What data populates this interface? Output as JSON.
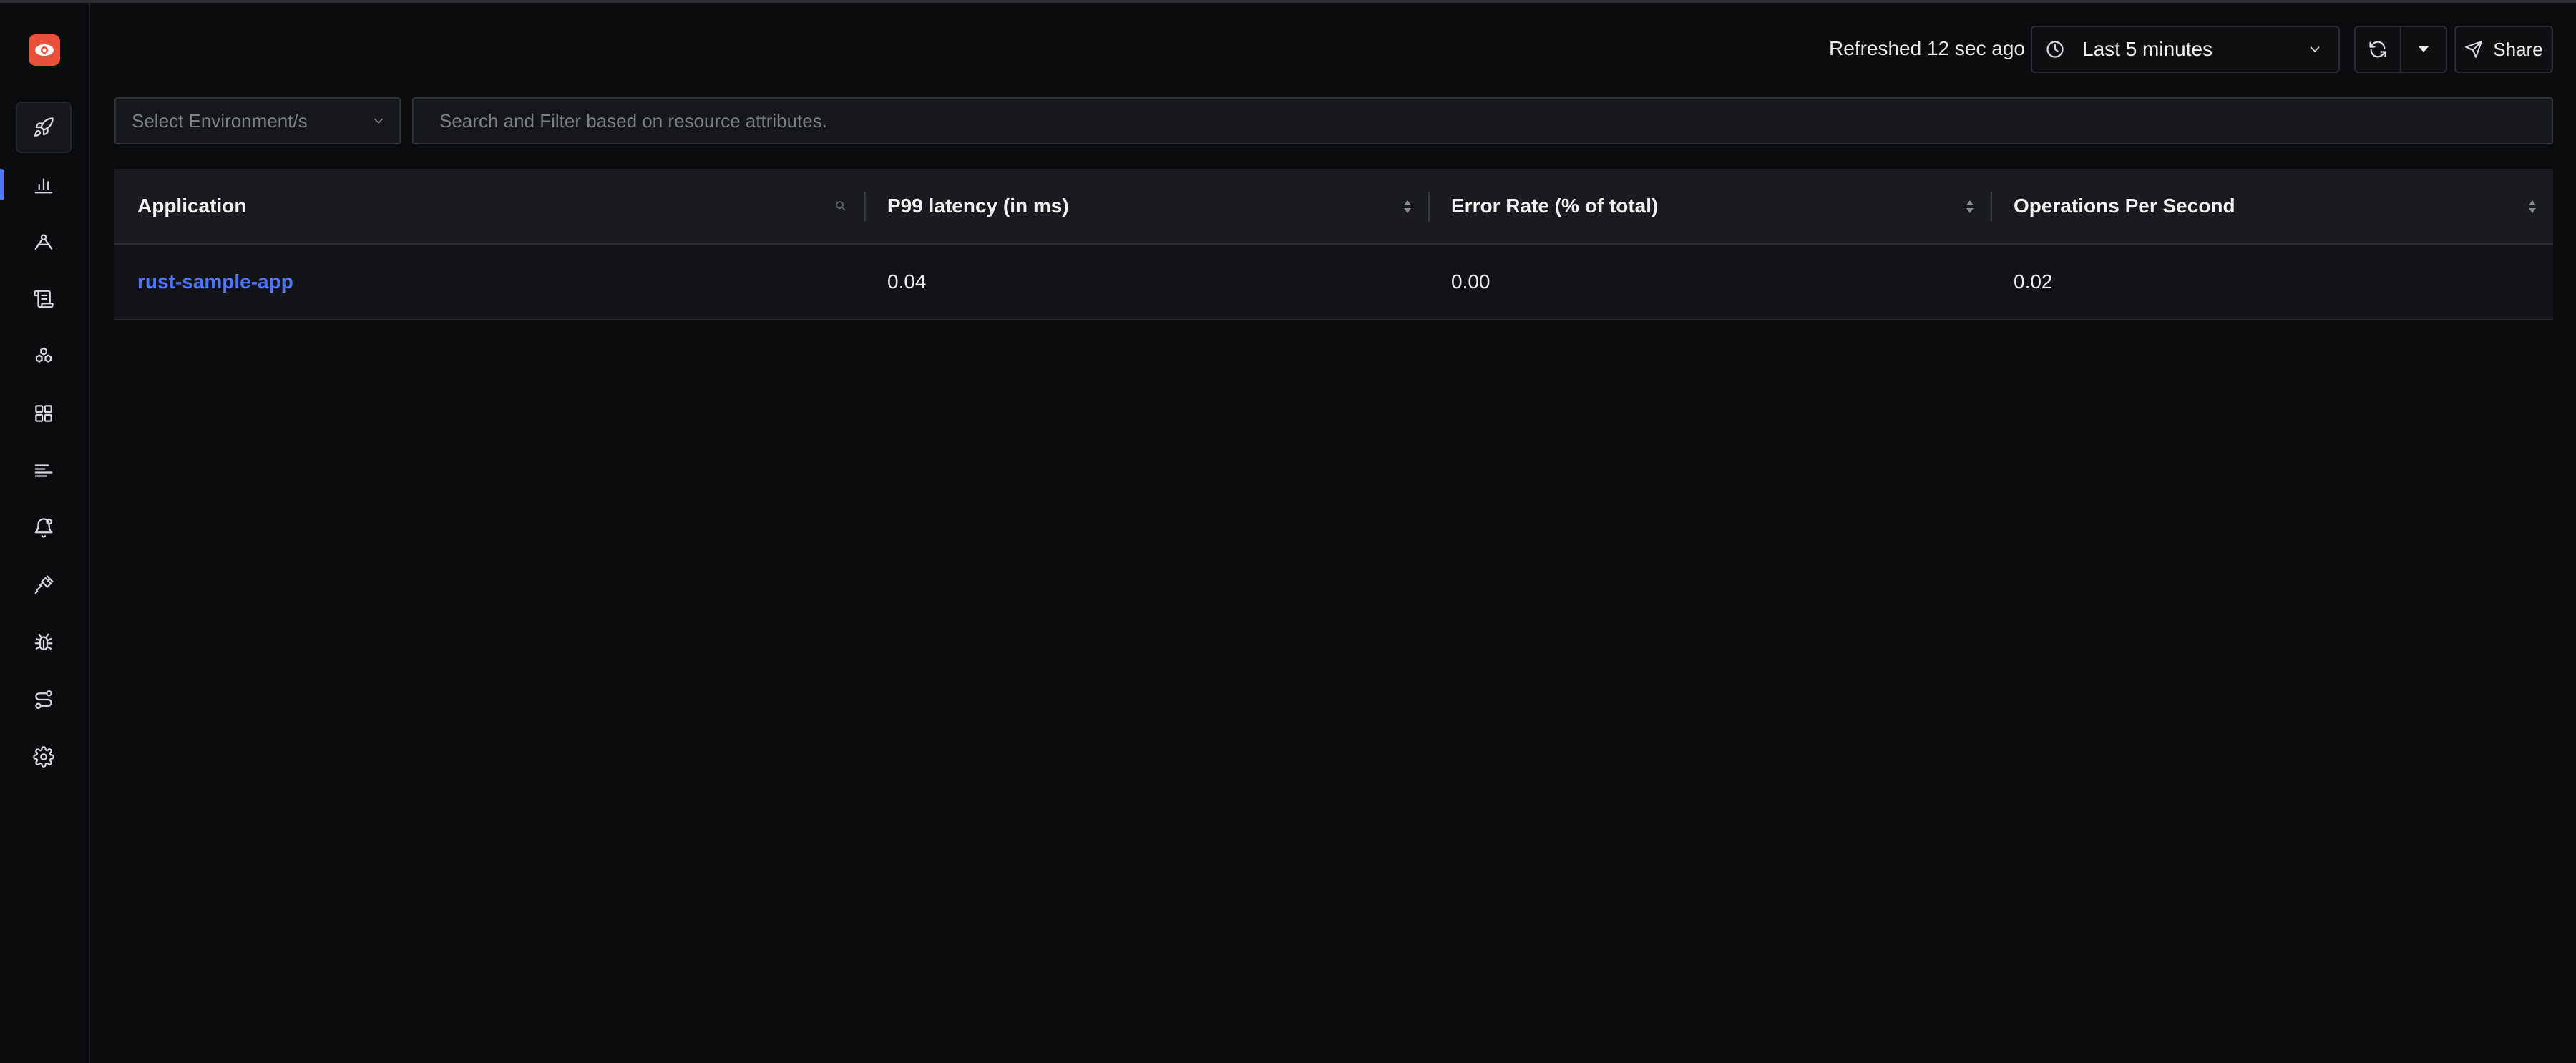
{
  "app": {
    "logo_icon": "eye-logo-icon",
    "accent": "#4e74f8",
    "brand": "#e8513a"
  },
  "sidebar": {
    "items": [
      {
        "name": "get-started",
        "icon": "rocket-icon"
      },
      {
        "name": "services",
        "icon": "bar-chart-icon"
      },
      {
        "name": "traces",
        "icon": "trace-explorer-icon"
      },
      {
        "name": "logs",
        "icon": "scroll-icon"
      },
      {
        "name": "infrastructure",
        "icon": "hexagons-icon"
      },
      {
        "name": "dashboards",
        "icon": "grid-icon"
      },
      {
        "name": "messaging-queues",
        "icon": "list-lines-icon"
      },
      {
        "name": "alerts",
        "icon": "bell-icon"
      },
      {
        "name": "integrations",
        "icon": "plug-icon"
      },
      {
        "name": "exceptions",
        "icon": "bug-icon"
      },
      {
        "name": "service-map",
        "icon": "route-icon"
      },
      {
        "name": "settings",
        "icon": "gear-icon"
      }
    ]
  },
  "header": {
    "refreshed_text": "Refreshed 12 sec ago",
    "time_range": "Last 5 minutes",
    "share_label": "Share"
  },
  "filters": {
    "environment_placeholder": "Select Environment/s",
    "search_placeholder": "Search and Filter based on resource attributes."
  },
  "table": {
    "columns": [
      "Application",
      "P99 latency (in ms)",
      "Error Rate (% of total)",
      "Operations Per Second"
    ],
    "rows": [
      {
        "application": "rust-sample-app",
        "p99": "0.04",
        "error_rate": "0.00",
        "ops": "0.02"
      }
    ]
  }
}
